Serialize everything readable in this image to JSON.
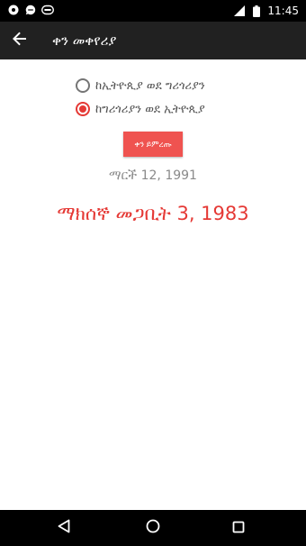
{
  "status_bar": {
    "time": "11:45",
    "left_icons": [
      "notification-icon",
      "chat-icon",
      "media-icon"
    ],
    "right_icons": [
      "signal-icon",
      "battery-icon"
    ]
  },
  "app_bar": {
    "title": "ቀን መቀየሪያ",
    "back_icon": "arrow-back-icon"
  },
  "conversion": {
    "options": [
      {
        "label": "ከኢትዮጲያ ወደ ግሪጎሪያን",
        "selected": false
      },
      {
        "label": "ከግሪጎሪያን ወደ ኢትዮጲያ",
        "selected": true
      }
    ],
    "convert_button": "ቀን ይምረጡ",
    "input_date": "ማርች 12, 1991",
    "result_date": "ማክሰኞ መጋቢት 3, 1983"
  },
  "colors": {
    "accent": "#e53935",
    "button": "#ef5350",
    "app_bar": "#212121",
    "status_bar": "#000000"
  },
  "nav_bar": {
    "icons": [
      "back-triangle-icon",
      "home-circle-icon",
      "recents-square-icon"
    ]
  }
}
